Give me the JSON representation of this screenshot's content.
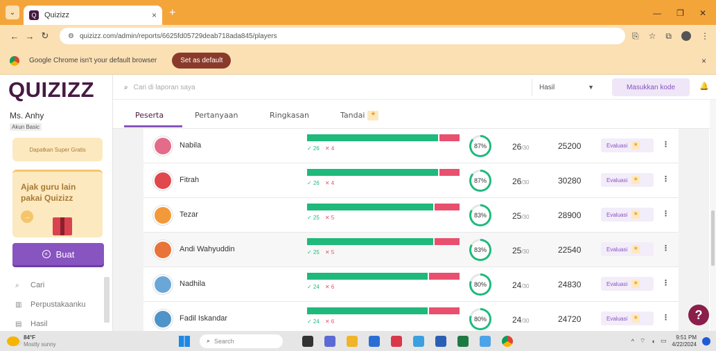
{
  "browser": {
    "tab_title": "Quizizz",
    "tab_close": "×",
    "new_tab": "+",
    "url": "quizizz.com/admin/reports/6625fd05729deab718ada845/players",
    "infobar_text": "Google Chrome isn't your default browser",
    "infobar_button": "Set as default",
    "infobar_close": "×"
  },
  "sidebar": {
    "logo": "QUIZIZZ",
    "user_name": "Ms. Anhy",
    "user_plan": "Akun Basic",
    "upgrade_label": "Dapatkan Super Gratis",
    "invite_text": "Ajak guru lain pakai Quizizz",
    "create_label": "Buat",
    "nav": [
      {
        "label": "Cari",
        "icon": "search-icon"
      },
      {
        "label": "Perpustakaanku",
        "icon": "library-icon"
      },
      {
        "label": "Hasil",
        "icon": "chart-icon"
      }
    ]
  },
  "topbar": {
    "search_placeholder": "Cari di laporan saya",
    "results_label": "Hasil",
    "code_button": "Masukkan kode"
  },
  "tabs": [
    {
      "label": "Peserta",
      "active": true
    },
    {
      "label": "Pertanyaan",
      "active": false
    },
    {
      "label": "Ringkasan",
      "active": false
    },
    {
      "label": "Tandai",
      "active": false
    }
  ],
  "eval_label": "Evaluasi",
  "players": [
    {
      "name": "Nabila",
      "correct": "✓ 26",
      "wrong": "✕ 4",
      "correct_frac": 0.867,
      "percent": "87%",
      "score": "26",
      "total": "/30",
      "points": "25200",
      "avatar_color": "#e36c8a"
    },
    {
      "name": "Fitrah",
      "correct": "✓ 26",
      "wrong": "✕ 4",
      "correct_frac": 0.867,
      "percent": "87%",
      "score": "26",
      "total": "/30",
      "points": "30280",
      "avatar_color": "#e0484d"
    },
    {
      "name": "Tezar",
      "correct": "✓ 25",
      "wrong": "✕ 5",
      "correct_frac": 0.833,
      "percent": "83%",
      "score": "25",
      "total": "/30",
      "points": "28900",
      "avatar_color": "#f29a3a"
    },
    {
      "name": "Andi Wahyuddin",
      "correct": "✓ 25",
      "wrong": "✕ 5",
      "correct_frac": 0.833,
      "percent": "83%",
      "score": "25",
      "total": "/30",
      "points": "22540",
      "avatar_color": "#e8743a"
    },
    {
      "name": "Nadhila",
      "correct": "✓ 24",
      "wrong": "✕ 6",
      "correct_frac": 0.8,
      "percent": "80%",
      "score": "24",
      "total": "/30",
      "points": "24830",
      "avatar_color": "#6aa7d6"
    },
    {
      "name": "Fadil Iskandar",
      "correct": "✓ 24",
      "wrong": "✕ 6",
      "correct_frac": 0.8,
      "percent": "80%",
      "score": "24",
      "total": "/30",
      "points": "24720",
      "avatar_color": "#4f94c8"
    }
  ],
  "help_label": "?",
  "taskbar": {
    "weather_temp": "84°F",
    "weather_desc": "Mostly sunny",
    "search_label": "Search",
    "time": "9:51 PM",
    "date": "4/22/2024"
  },
  "colors": {
    "brand": "#461a42",
    "accent": "#8854c0",
    "correct": "#1fb97b",
    "wrong": "#e8506e",
    "chrome_bar": "#f4a53a"
  }
}
